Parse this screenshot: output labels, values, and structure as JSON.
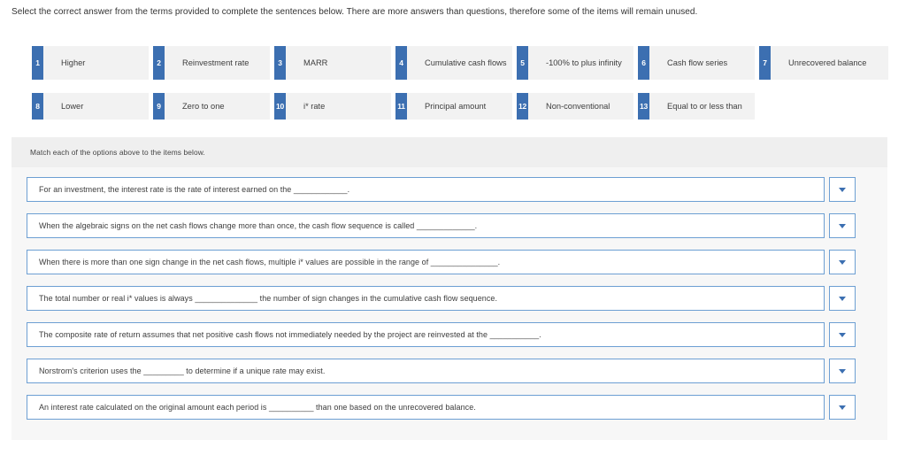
{
  "instruction": "Select the correct answer from the terms provided to complete the sentences below. There are more answers than questions, therefore some of the items will remain unused.",
  "colors": {
    "accent_blue": "#3c6fb1",
    "term_background": "#f2f2f2",
    "panel_header": "#efefef",
    "panel_body": "#f7f7f7",
    "field_border": "#6d9fd3"
  },
  "term_bank": {
    "row1": [
      {
        "number": "1",
        "label": "Higher"
      },
      {
        "number": "2",
        "label": "Reinvestment rate"
      },
      {
        "number": "3",
        "label": "MARR"
      },
      {
        "number": "4",
        "label": "Cumulative cash flows"
      },
      {
        "number": "5",
        "label": "-100% to plus infinity"
      },
      {
        "number": "6",
        "label": "Cash flow series"
      },
      {
        "number": "7",
        "label": "Unrecovered balance"
      }
    ],
    "row2": [
      {
        "number": "8",
        "label": "Lower"
      },
      {
        "number": "9",
        "label": "Zero to one"
      },
      {
        "number": "10",
        "label": "i* rate"
      },
      {
        "number": "11",
        "label": "Principal amount"
      },
      {
        "number": "12",
        "label": "Non-conventional"
      },
      {
        "number": "13",
        "label": "Equal to or less than"
      }
    ]
  },
  "panel": {
    "header": "Match each of the options above to the items below.",
    "questions": [
      {
        "text": "For an investment, the interest rate is the rate of interest earned on the ____________.",
        "selected": "",
        "dropdown_icon": "chevron-down-icon"
      },
      {
        "text": "When the algebraic signs on the net cash flows change more than once, the cash flow sequence is called _____________.",
        "selected": "",
        "dropdown_icon": "chevron-down-icon"
      },
      {
        "text": "When there is more than one sign change in the net cash flows, multiple i* values are possible in the range of _______________.",
        "selected": "",
        "dropdown_icon": "chevron-down-icon"
      },
      {
        "text": "The total number or real i* values is always ______________ the number of sign changes in the cumulative cash flow sequence.",
        "selected": "",
        "dropdown_icon": "chevron-down-icon"
      },
      {
        "text": "The composite rate of return assumes that net positive cash flows not immediately needed by the project are reinvested at the ___________.",
        "selected": "",
        "dropdown_icon": "chevron-down-icon"
      },
      {
        "text": "Norstrom's criterion uses the _________ to determine if a unique rate may exist.",
        "selected": "",
        "dropdown_icon": "chevron-down-icon"
      },
      {
        "text": "An interest rate calculated on the original amount each period is __________ than one based on the unrecovered balance.",
        "selected": "",
        "dropdown_icon": "chevron-down-icon"
      }
    ]
  }
}
